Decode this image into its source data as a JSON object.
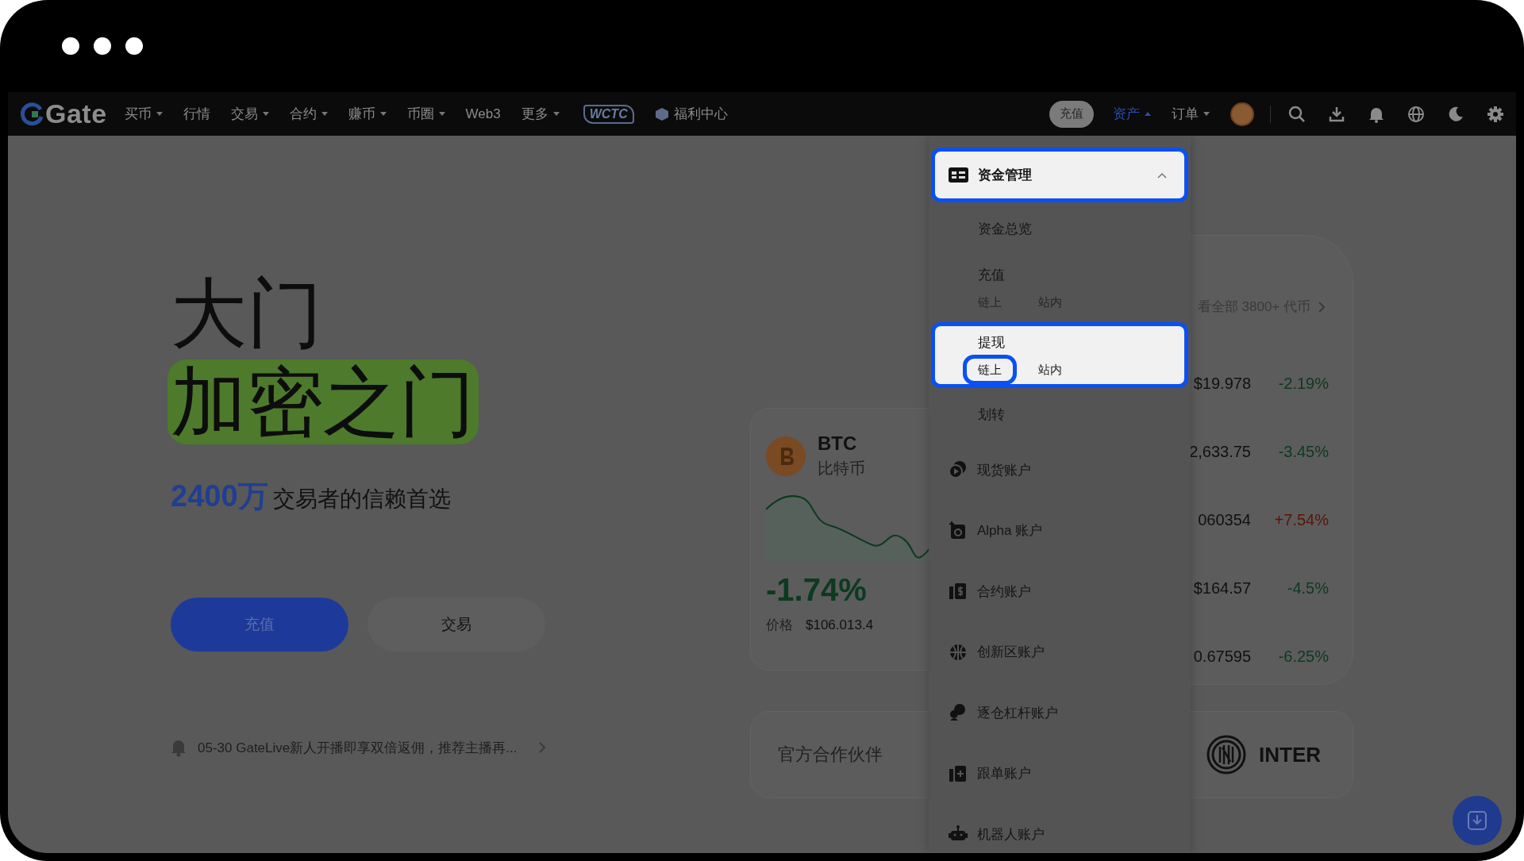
{
  "nav": {
    "logo": "Gate",
    "items": [
      {
        "label": "买币",
        "has_menu": true
      },
      {
        "label": "行情",
        "has_menu": false
      },
      {
        "label": "交易",
        "has_menu": true
      },
      {
        "label": "合约",
        "has_menu": true
      },
      {
        "label": "赚币",
        "has_menu": true
      },
      {
        "label": "币圈",
        "has_menu": true
      },
      {
        "label": "Web3",
        "has_menu": false
      },
      {
        "label": "更多",
        "has_menu": true
      }
    ],
    "event_logo": "WCTC",
    "rewards": "福利中心",
    "deposit_button": "充值",
    "menus": [
      {
        "label": "资产",
        "expanded": true
      },
      {
        "label": "订单",
        "expanded": false
      }
    ]
  },
  "hero": {
    "title_line_1": "大门",
    "title_line_2": "加密之门",
    "tagline_highlight": "2400万",
    "tagline": "交易者的信赖首选",
    "buttons": [
      {
        "label": "充值",
        "kind": "primary"
      },
      {
        "label": "交易",
        "kind": "secondary"
      }
    ],
    "notice": "05-30 GateLive新人开播即享双倍返佣，推荐主播再..."
  },
  "btc_card": {
    "symbol": "BTC",
    "name": "比特币",
    "change": "-1.74%",
    "price_label": "价格",
    "price": "$106.013.4",
    "rising": false
  },
  "market_card": {
    "view_all": "看全部 3800+ 代币",
    "rows": [
      {
        "price": "$19.978",
        "change": "-2.19%",
        "rising": false
      },
      {
        "price": "2,633.75",
        "change": "-3.45%",
        "rising": false
      },
      {
        "price": "060354",
        "change": "+7.54%",
        "rising": true
      },
      {
        "price": "$164.57",
        "change": "-4.5%",
        "rising": false
      },
      {
        "price": "0.67595",
        "change": "-6.25%",
        "rising": false
      }
    ]
  },
  "partner_card": {
    "label": "官方合作伙伴",
    "partner": "INTER"
  },
  "asset_menu": {
    "section": {
      "label": "资金管理",
      "expanded": true,
      "highlighted": true
    },
    "links": [
      {
        "label": "资金总览",
        "highlighted": false
      },
      {
        "label": "充值",
        "highlighted": false,
        "options": [
          {
            "label": "链上",
            "highlighted": false
          },
          {
            "label": "站内",
            "highlighted": false
          }
        ]
      },
      {
        "label": "提现",
        "highlighted": true,
        "options": [
          {
            "label": "链上",
            "highlighted": true
          },
          {
            "label": "站内",
            "highlighted": false
          }
        ]
      },
      {
        "label": "划转",
        "highlighted": false
      }
    ],
    "accounts": [
      {
        "label": "现货账户"
      },
      {
        "label": "Alpha 账户"
      },
      {
        "label": "合约账户"
      },
      {
        "label": "创新区账户"
      },
      {
        "label": "逐仓杠杆账户"
      },
      {
        "label": "跟单账户"
      },
      {
        "label": "机器人账户"
      }
    ]
  }
}
